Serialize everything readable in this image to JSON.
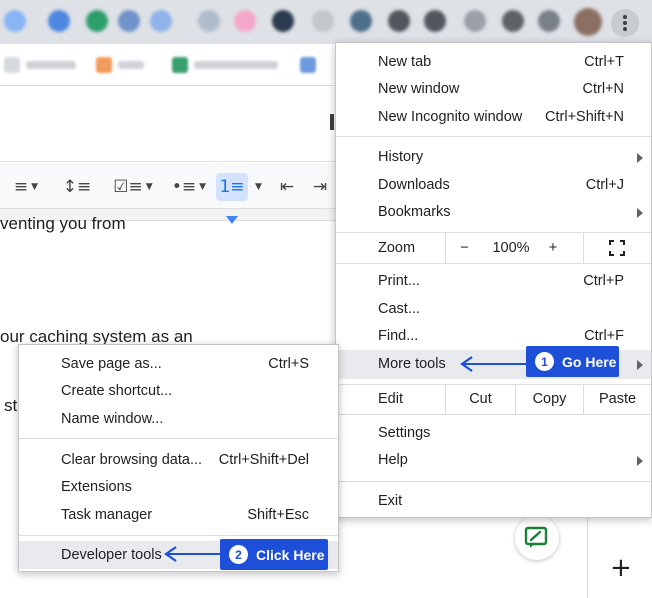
{
  "doc": {
    "lines": [
      "venting you from",
      "our caching system as an",
      "st"
    ]
  },
  "menu": {
    "new_tab": {
      "label": "New tab",
      "shortcut": "Ctrl+T"
    },
    "new_window": {
      "label": "New window",
      "shortcut": "Ctrl+N"
    },
    "new_incognito": {
      "label": "New Incognito window",
      "shortcut": "Ctrl+Shift+N"
    },
    "history": {
      "label": "History"
    },
    "downloads": {
      "label": "Downloads",
      "shortcut": "Ctrl+J"
    },
    "bookmarks": {
      "label": "Bookmarks"
    },
    "zoom": {
      "label": "Zoom",
      "minus": "−",
      "value": "100%",
      "plus": "+"
    },
    "print": {
      "label": "Print...",
      "shortcut": "Ctrl+P"
    },
    "cast": {
      "label": "Cast..."
    },
    "find": {
      "label": "Find...",
      "shortcut": "Ctrl+F"
    },
    "more_tools": {
      "label": "More tools"
    },
    "edit": {
      "label": "Edit",
      "cut": "Cut",
      "copy": "Copy",
      "paste": "Paste"
    },
    "settings": {
      "label": "Settings"
    },
    "help": {
      "label": "Help"
    },
    "exit": {
      "label": "Exit"
    }
  },
  "submenu": {
    "save_page": {
      "label": "Save page as...",
      "shortcut": "Ctrl+S"
    },
    "create_shortcut": {
      "label": "Create shortcut..."
    },
    "name_window": {
      "label": "Name window..."
    },
    "clear_browsing": {
      "label": "Clear browsing data...",
      "shortcut": "Ctrl+Shift+Del"
    },
    "extensions": {
      "label": "Extensions"
    },
    "task_manager": {
      "label": "Task manager",
      "shortcut": "Shift+Esc"
    },
    "developer_tools": {
      "label": "Developer tools"
    }
  },
  "callouts": {
    "one": {
      "num": "1",
      "text": "Go Here"
    },
    "two": {
      "num": "2",
      "text": "Click Here"
    }
  },
  "colors": {
    "callout": "#1e4fd8",
    "highlight": "#e8eaed",
    "active_tool": "#d3e3fd"
  }
}
